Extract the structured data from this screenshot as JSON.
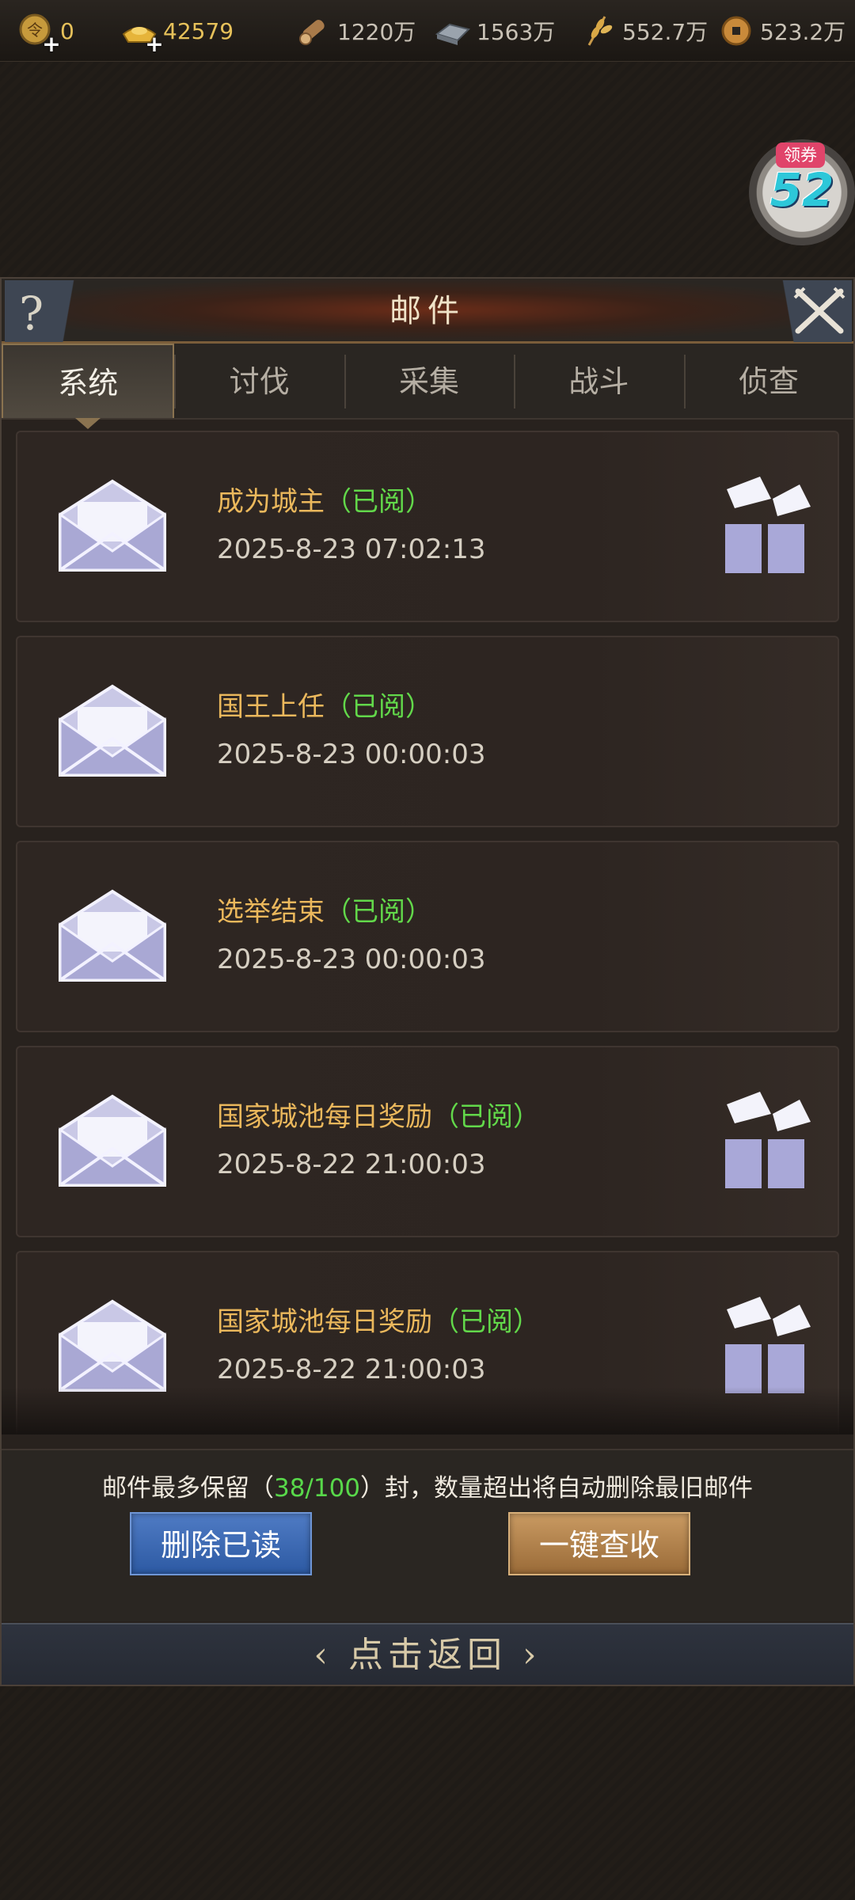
{
  "topbar": {
    "resources": [
      {
        "icon": "token-icon",
        "value": "0"
      },
      {
        "icon": "gold-ingot-icon",
        "value": "42579"
      },
      {
        "icon": "wood-icon",
        "value": "1220万"
      },
      {
        "icon": "iron-icon",
        "value": "1563万"
      },
      {
        "icon": "grain-icon",
        "value": "552.7万"
      },
      {
        "icon": "copper-coin-icon",
        "value": "523.2万"
      }
    ]
  },
  "coupon": {
    "tag": "领券",
    "number": "52"
  },
  "panel": {
    "title": "邮件",
    "help_label": "?",
    "tabs": [
      {
        "label": "系统",
        "active": true
      },
      {
        "label": "讨伐",
        "active": false
      },
      {
        "label": "采集",
        "active": false
      },
      {
        "label": "战斗",
        "active": false
      },
      {
        "label": "侦查",
        "active": false
      }
    ]
  },
  "mails": [
    {
      "title": "成为城主",
      "status": "（已阅）",
      "date": "2025-8-23 07:02:13",
      "has_gift": true
    },
    {
      "title": "国王上任",
      "status": "（已阅）",
      "date": "2025-8-23 00:00:03",
      "has_gift": false
    },
    {
      "title": "选举结束",
      "status": "（已阅）",
      "date": "2025-8-23 00:00:03",
      "has_gift": false
    },
    {
      "title": "国家城池每日奖励",
      "status": "（已阅）",
      "date": "2025-8-22 21:00:03",
      "has_gift": true
    },
    {
      "title": "国家城池每日奖励",
      "status": "（已阅）",
      "date": "2025-8-22 21:00:03",
      "has_gift": true
    }
  ],
  "footer": {
    "notice_prefix": "邮件最多保留（",
    "notice_count": "38/100",
    "notice_suffix": "）封，数量超出将自动删除最旧邮件",
    "delete_read_label": "删除已读",
    "collect_all_label": "一键查收"
  },
  "back": {
    "label": "‹ 点击返回 ›"
  },
  "colors": {
    "mail_title": "#ebb85c",
    "read_status": "#62d84a",
    "count_highlight": "#58d84a",
    "button_blue": "#3f6bb6",
    "button_orange": "#b6844b"
  }
}
